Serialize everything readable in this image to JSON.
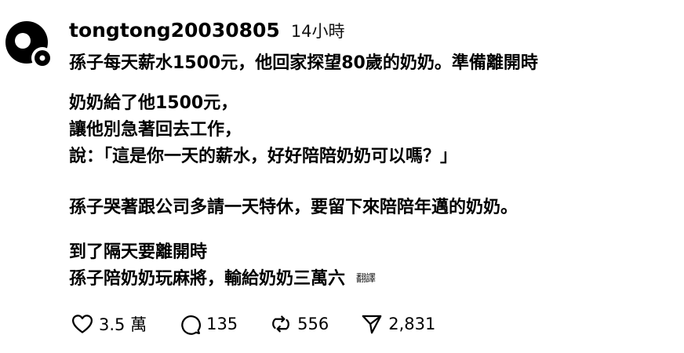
{
  "post": {
    "username": "tongtong20030805",
    "timestamp": "14小時",
    "lines": {
      "p1": "孫子每天薪水1500元，他回家探望80歲的奶奶。準備離開時",
      "p2_1": "奶奶給了他1500元，",
      "p2_2": "讓他別急著回去工作，",
      "p2_3": "說：「這是你一天的薪水，好好陪陪奶奶可以嗎？」",
      "p3": "孫子哭著跟公司多請一天特休，要留下來陪陪年邁的奶奶。",
      "p4_1": "到了隔天要離開時",
      "p4_2": "孫子陪奶奶玩麻將，輸給奶奶三萬六"
    },
    "translate_label": "翻譯",
    "actions": {
      "likes": "3.5 萬",
      "comments": "135",
      "reposts": "556",
      "shares": "2,831"
    }
  }
}
